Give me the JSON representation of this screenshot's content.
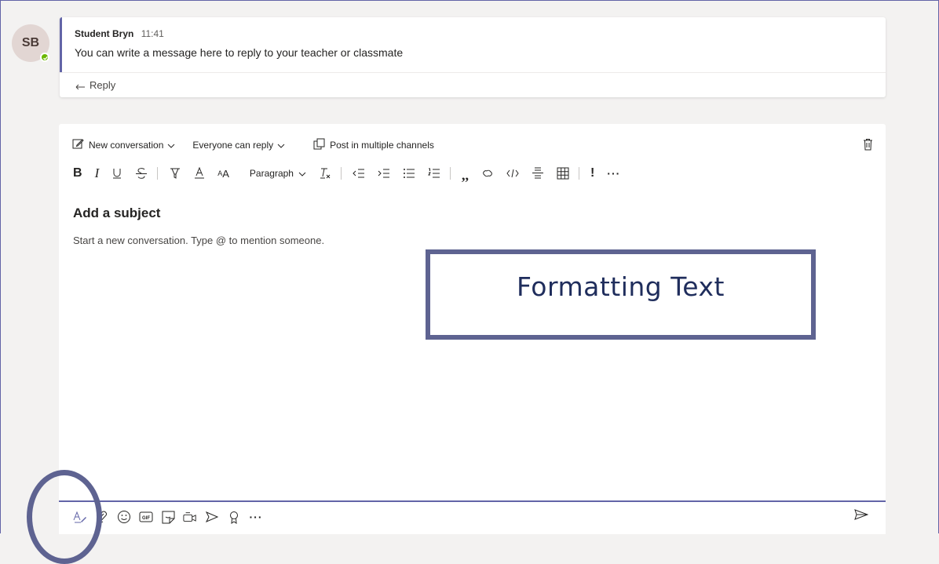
{
  "thread": {
    "avatar_initials": "SB",
    "author": "Student Bryn",
    "time": "11:41",
    "message": "You can write a message here to reply to your teacher or classmate",
    "reply_label": "Reply"
  },
  "compose": {
    "new_conversation_label": "New conversation",
    "reply_setting_label": "Everyone can reply",
    "post_multiple_label": "Post in multiple channels",
    "paragraph_label": "Paragraph",
    "subject_placeholder": "Add a subject",
    "body_placeholder": "Start a new conversation. Type @ to mention someone."
  },
  "callout": {
    "text": "Formatting Text"
  },
  "colors": {
    "accent": "#6264a7",
    "presence": "#6bb700",
    "annotation": "#5e6391"
  },
  "icons": {
    "formatting_toolbar": [
      "bold-icon",
      "italic-icon",
      "underline-icon",
      "strikethrough-icon",
      "highlight-icon",
      "font-color-icon",
      "font-size-icon",
      "clear-formatting-icon",
      "decrease-indent-icon",
      "increase-indent-icon",
      "bulleted-list-icon",
      "numbered-list-icon",
      "quote-icon",
      "link-icon",
      "code-snippet-icon",
      "horizontal-rule-icon",
      "table-icon",
      "important-icon",
      "more-options-icon"
    ],
    "bottom_toolbar": [
      "format-icon",
      "attach-icon",
      "emoji-icon",
      "gif-icon",
      "sticker-icon",
      "meet-now-icon",
      "stream-icon",
      "praise-icon",
      "more-icon",
      "send-icon"
    ]
  }
}
